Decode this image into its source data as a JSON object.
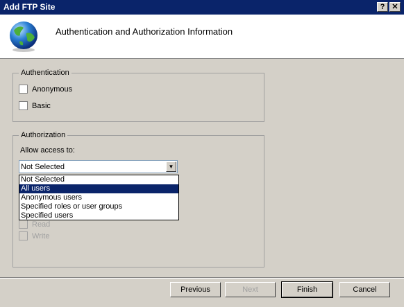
{
  "window": {
    "title": "Add FTP Site",
    "help_label": "?",
    "close_label": "✕"
  },
  "header": {
    "title": "Authentication and Authorization Information"
  },
  "authentication": {
    "legend": "Authentication",
    "anonymous_label": "Anonymous",
    "basic_label": "Basic"
  },
  "authorization": {
    "legend": "Authorization",
    "allow_access_label": "Allow access to:",
    "selected_value": "Not Selected",
    "options": [
      "Not Selected",
      "All users",
      "Anonymous users",
      "Specified roles or user groups",
      "Specified users"
    ],
    "highlighted_option": "All users",
    "read_label": "Read",
    "write_label": "Write"
  },
  "footer": {
    "previous_label": "Previous",
    "next_label": "Next",
    "finish_label": "Finish",
    "cancel_label": "Cancel"
  },
  "colors": {
    "title_bar": "#0a246a",
    "selection": "#0a246a",
    "dialog_bg": "#d4d0c8"
  }
}
